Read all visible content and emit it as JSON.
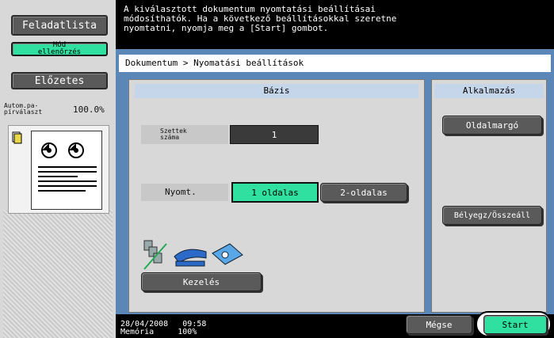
{
  "left": {
    "job_list_label": "Feladatlista",
    "mode_check_label": "Mód\nellenőrzés",
    "preview_label": "Előzetes",
    "zoom_label": "Autom.pa-\npírválaszt",
    "zoom_value": "100.0%"
  },
  "message": "A kiválasztott dokumentum nyomtatási beállításai\nmódosíthatók. Ha a következő beállításokkal szeretne\nnyomtatni, nyomja meg a [Start] gombot.",
  "breadcrumb": "Dokumentum > Nyomatási beállítások",
  "basis": {
    "title": "Bázis",
    "copies_label": "Szettek\nszáma",
    "copies_value": "1",
    "print_label": "Nyomt.",
    "one_sided": "1 oldalas",
    "two_sided": "2-oldalas",
    "handling_label": "Kezelés"
  },
  "application": {
    "title": "Alkalmazás",
    "margin_label": "Oldalmargó",
    "stamp_label": "Bélyegz/Összeáll"
  },
  "status": {
    "date": "28/04/2008",
    "time": "09:58",
    "memory_label": "Memória",
    "memory_value": "100%"
  },
  "cancel_label": "Mégse",
  "start_label": "Start"
}
